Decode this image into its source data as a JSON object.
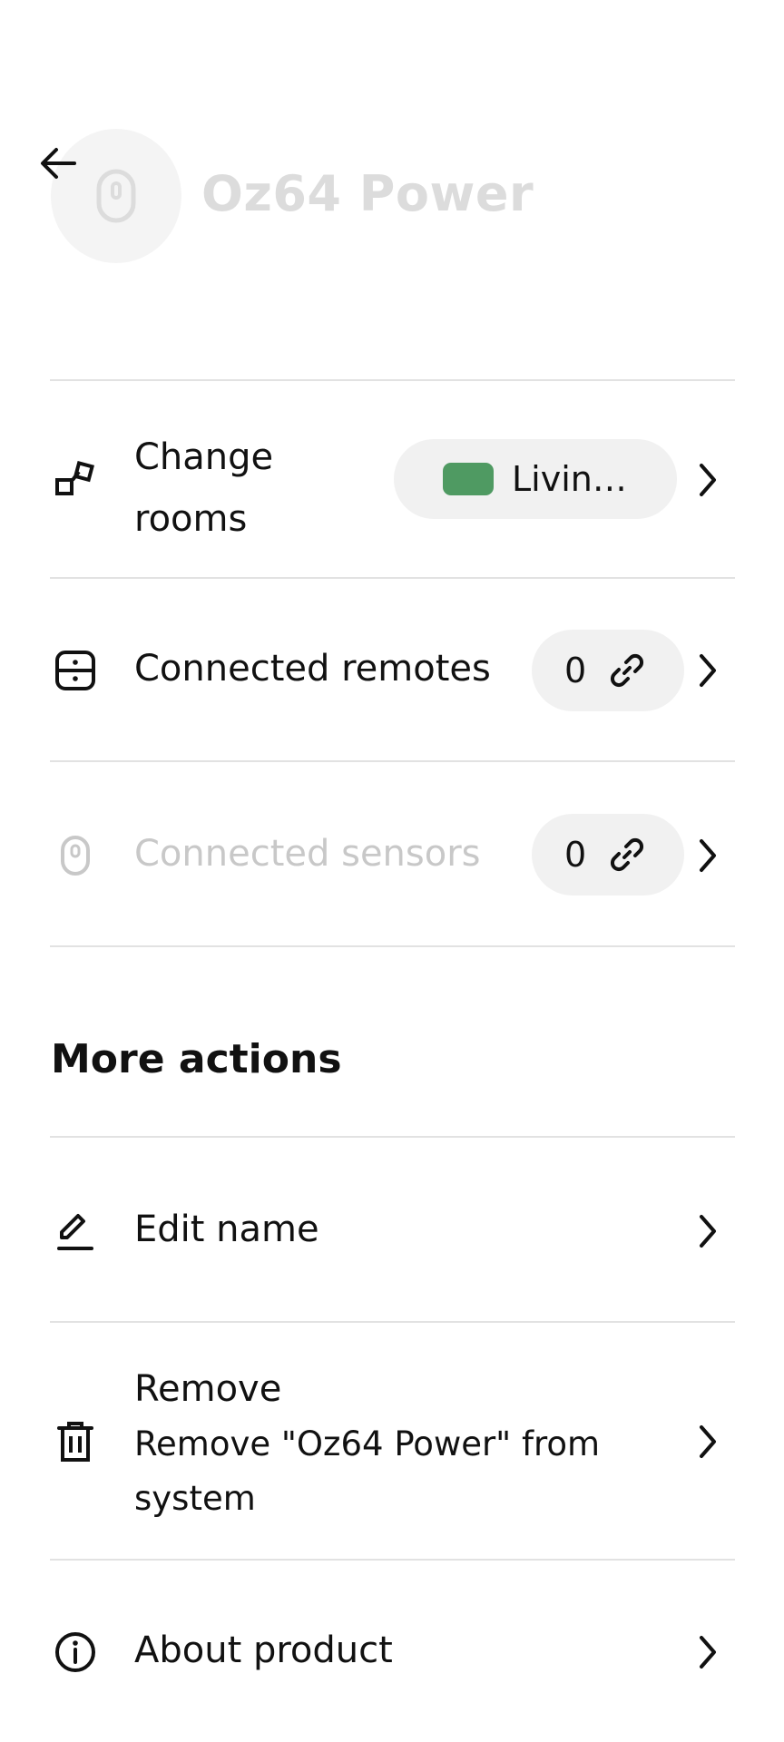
{
  "header": {
    "title": "Oz64 Power",
    "back_icon": "arrow-left-icon",
    "device_icon": "sensor-icon"
  },
  "rows": {
    "change_rooms": {
      "label_line1": "Change",
      "label_line2": "rooms",
      "room_name": "Livin…",
      "room_color": "#4f9a62",
      "icon": "rooms-icon"
    },
    "connected_remotes": {
      "label": "Connected remotes",
      "count": "0",
      "icon": "remote-icon"
    },
    "connected_sensors": {
      "label": "Connected sensors",
      "count": "0",
      "icon": "sensor-icon"
    }
  },
  "more_actions": {
    "title": "More actions",
    "edit_name": {
      "label": "Edit name",
      "icon": "pencil-icon"
    },
    "remove": {
      "title": "Remove",
      "subtitle": "Remove \"Oz64 Power\" from system",
      "icon": "trash-icon"
    },
    "about": {
      "label": "About product",
      "icon": "info-icon"
    }
  }
}
